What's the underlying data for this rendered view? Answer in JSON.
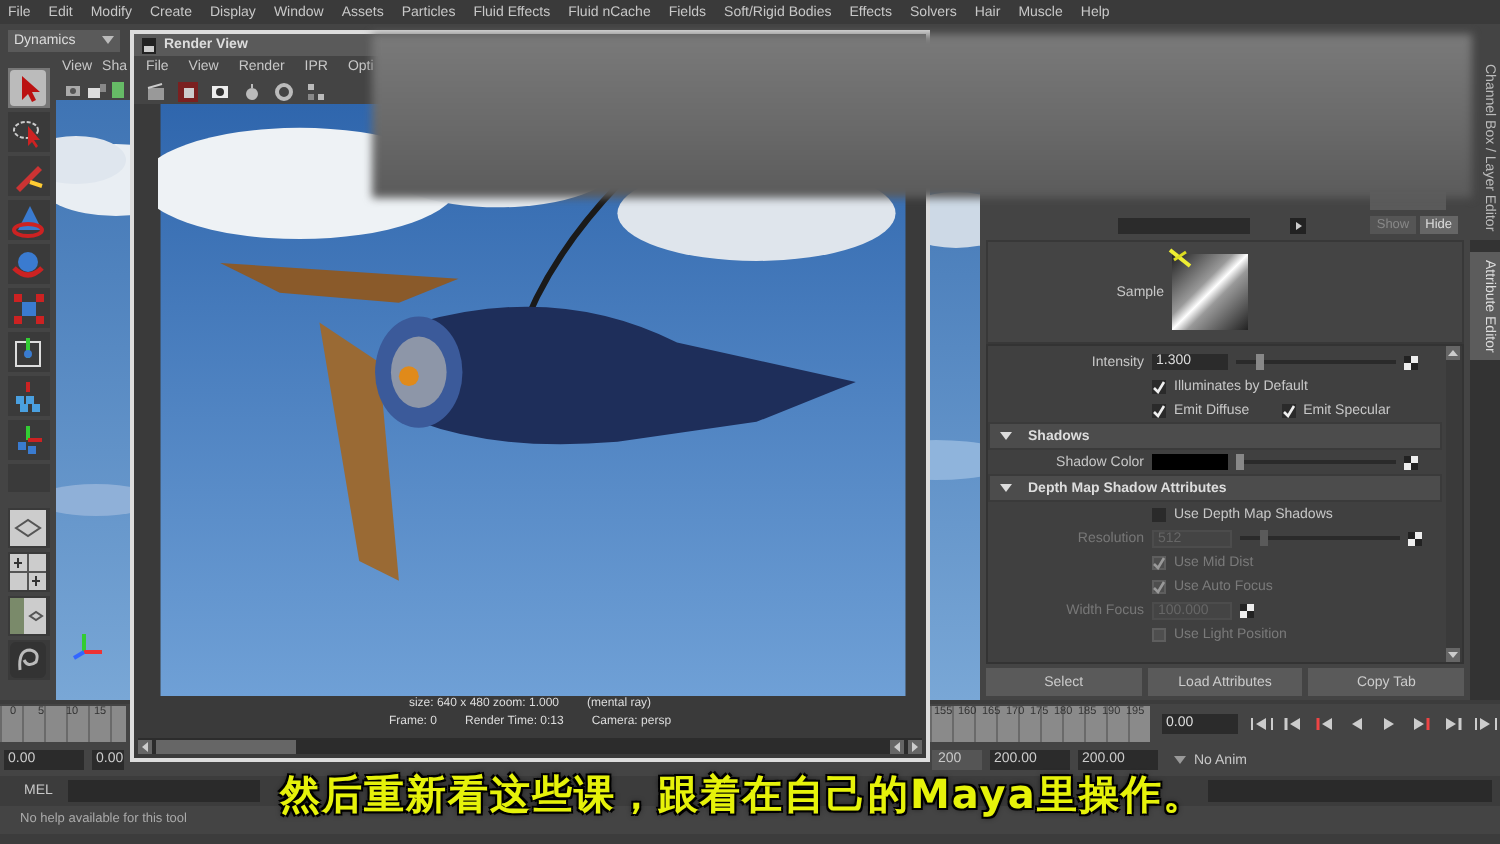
{
  "menu_bar": [
    "File",
    "Edit",
    "Modify",
    "Create",
    "Display",
    "Window",
    "Assets",
    "Particles",
    "Fluid Effects",
    "Fluid nCache",
    "Fields",
    "Soft/Rigid Bodies",
    "Effects",
    "Solvers",
    "Hair",
    "Muscle",
    "Help"
  ],
  "menu_set": {
    "value": "Dynamics"
  },
  "viewport": {
    "menu": [
      "View",
      "Sha"
    ]
  },
  "render_view": {
    "title": "Render View",
    "menu": [
      "File",
      "View",
      "Render",
      "IPR",
      "Opti"
    ],
    "image_info": "size: 640 x 480 zoom: 1.000",
    "renderer": "(mental ray)",
    "frame": "Frame: 0",
    "render_time": "Render Time: 0:13",
    "camera": "Camera: persp"
  },
  "attribute_editor": {
    "show_button": "Show",
    "hide_button": "Hide",
    "sample_label": "Sample",
    "rows": [
      {
        "kind": "slider",
        "label": "Intensity",
        "value": "1.300",
        "level": 0.13,
        "disabled": false
      },
      {
        "kind": "checks",
        "items": [
          {
            "label": "Illuminates by Default",
            "checked": true,
            "disabled": false
          }
        ]
      },
      {
        "kind": "checks",
        "items": [
          {
            "label": "Emit Diffuse",
            "checked": true,
            "disabled": false
          },
          {
            "label": "Emit Specular",
            "checked": true,
            "disabled": false
          }
        ]
      },
      {
        "kind": "section",
        "label": "Shadows",
        "expanded": true
      },
      {
        "kind": "color",
        "label": "Shadow Color",
        "level": 0,
        "disabled": false
      },
      {
        "kind": "section",
        "label": "Depth Map Shadow Attributes",
        "expanded": true
      },
      {
        "kind": "checks",
        "items": [
          {
            "label": "Use Depth Map Shadows",
            "checked": false,
            "disabled": false
          }
        ]
      },
      {
        "kind": "slider",
        "label": "Resolution",
        "value": "512",
        "level": 0.13,
        "disabled": true
      },
      {
        "kind": "checks",
        "items": [
          {
            "label": "Use Mid Dist",
            "checked": true,
            "disabled": true
          }
        ]
      },
      {
        "kind": "checks",
        "items": [
          {
            "label": "Use Auto Focus",
            "checked": true,
            "disabled": true
          }
        ]
      },
      {
        "kind": "field",
        "label": "Width Focus",
        "value": "100.000",
        "disabled": true
      },
      {
        "kind": "checks",
        "items": [
          {
            "label": "Use Light Position",
            "checked": false,
            "disabled": true
          }
        ]
      }
    ],
    "buttons": [
      "Select",
      "Load Attributes",
      "Copy Tab"
    ]
  },
  "side_tabs": [
    {
      "label": "Channel Box / Layer Editor",
      "selected": false
    },
    {
      "label": "Attribute Editor",
      "selected": true
    }
  ],
  "time_slider": {
    "ticks_start": [
      "0",
      "5",
      "10",
      "15"
    ],
    "ticks_end": [
      "155",
      "160",
      "165",
      "170",
      "175",
      "180",
      "185",
      "190",
      "195"
    ],
    "current_time": "0.00"
  },
  "range_slider": {
    "start_time": "0.00",
    "playback_start": "0.00",
    "range_end": "200",
    "playback_end": "200.00",
    "end_time": "200.00",
    "anim_layer": "No Anim"
  },
  "command_line": {
    "label": "MEL"
  },
  "help_line": "No help available for this tool",
  "subtitle": "然后重新看这些课，跟着在自己的Maya里操作。"
}
